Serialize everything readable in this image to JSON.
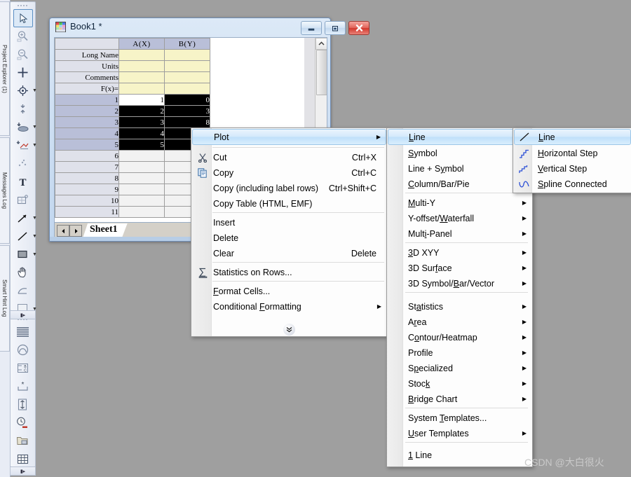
{
  "app": {
    "background_color": "#9f9f9f"
  },
  "left_dock": {
    "tabs": [
      {
        "label": "Project Explorer (1)"
      },
      {
        "label": "Messages Log"
      },
      {
        "label": "Smart Hint Log"
      }
    ]
  },
  "toolbar_main": {
    "name": "Tools",
    "buttons": [
      {
        "icon": "pointer-icon",
        "selected": true
      },
      {
        "icon": "zoom-in-icon",
        "selected": false
      },
      {
        "icon": "zoom-out-icon",
        "selected": false
      },
      {
        "icon": "data-reader-icon",
        "selected": false
      },
      {
        "icon": "screen-reader-icon",
        "selected": false,
        "dropdown": true
      },
      {
        "icon": "data-selector-icon",
        "selected": false
      },
      {
        "icon": "regional-mask-icon",
        "selected": false,
        "dropdown": true
      },
      {
        "icon": "regional-data-icon",
        "selected": false,
        "dropdown": true
      },
      {
        "icon": "scatter-points-icon",
        "selected": false
      },
      {
        "icon": "text-tool-icon",
        "selected": false
      },
      {
        "icon": "rectangle-select-icon",
        "selected": false
      },
      {
        "icon": "arrow-tool-icon",
        "selected": false,
        "dropdown": true
      },
      {
        "icon": "line-tool-icon",
        "selected": false,
        "dropdown": true
      },
      {
        "icon": "rectangle-tool-icon",
        "selected": false,
        "dropdown": true
      },
      {
        "icon": "pan-hand-icon",
        "selected": false
      },
      {
        "icon": "region-tool-icon",
        "selected": false
      },
      {
        "icon": "equation-icon",
        "selected": false,
        "dropdown": true
      },
      {
        "icon": "graph-insert-icon",
        "selected": false,
        "dropdown": true
      },
      {
        "icon": "rotate-hand-icon",
        "selected": false
      },
      {
        "icon": "3d-box-icon",
        "selected": false
      }
    ]
  },
  "toolbar_second": {
    "name": "Object Edit",
    "buttons": [
      {
        "icon": "layers-icon"
      },
      {
        "icon": "speedmode-icon"
      },
      {
        "icon": "rename-icon"
      },
      {
        "icon": "merge-icon"
      },
      {
        "icon": "align-icon"
      },
      {
        "icon": "clock-stamp-icon"
      },
      {
        "icon": "project-stamp-icon"
      },
      {
        "icon": "grid-icon"
      }
    ]
  },
  "workbook": {
    "title": "Book1 *",
    "icon": "workbook-icon",
    "window_buttons": {
      "minimize": "minimize-icon",
      "maximize": "restore-icon",
      "close": "close-icon"
    },
    "columns": [
      "A(X)",
      "B(Y)"
    ],
    "label_rows": [
      {
        "name": "Long Name",
        "values": [
          "",
          ""
        ]
      },
      {
        "name": "Units",
        "values": [
          "",
          ""
        ]
      },
      {
        "name": "Comments",
        "values": [
          "",
          ""
        ]
      },
      {
        "name": "F(x)=",
        "values": [
          "",
          ""
        ]
      }
    ],
    "data_rows": [
      {
        "row": "1",
        "values": [
          "1",
          "0"
        ],
        "selected": true
      },
      {
        "row": "2",
        "values": [
          "2",
          "3"
        ],
        "selected": true
      },
      {
        "row": "3",
        "values": [
          "3",
          "8"
        ],
        "selected": true
      },
      {
        "row": "4",
        "values": [
          "4",
          ""
        ],
        "selected": true
      },
      {
        "row": "5",
        "values": [
          "5",
          ""
        ],
        "selected": true
      },
      {
        "row": "6",
        "values": [
          "",
          ""
        ],
        "selected": false
      },
      {
        "row": "7",
        "values": [
          "",
          ""
        ],
        "selected": false
      },
      {
        "row": "8",
        "values": [
          "",
          ""
        ],
        "selected": false
      },
      {
        "row": "9",
        "values": [
          "",
          ""
        ],
        "selected": false
      },
      {
        "row": "10",
        "values": [
          "",
          ""
        ],
        "selected": false
      },
      {
        "row": "11",
        "values": [
          "",
          ""
        ],
        "selected": false
      }
    ],
    "sheet_tab": "Sheet1",
    "tab_prev_icon": "triangle-left-icon",
    "tab_next_icon": "triangle-right-icon",
    "scroll_up_icon": "chevron-up-icon"
  },
  "context_menu": {
    "items": [
      {
        "label": "Plot",
        "accel": "",
        "icon": "",
        "submenu": true,
        "highlighted": true,
        "sep_after": true
      },
      {
        "label": "Cut",
        "accel": "Ctrl+X",
        "icon": "scissors-icon",
        "submenu": false,
        "highlighted": false
      },
      {
        "label": "Copy",
        "accel": "Ctrl+C",
        "icon": "copy-icon",
        "submenu": false,
        "highlighted": false
      },
      {
        "label": "Copy (including label rows)",
        "accel": "Ctrl+Shift+C",
        "icon": "",
        "submenu": false,
        "highlighted": false
      },
      {
        "label": "Copy Table (HTML, EMF)",
        "accel": "",
        "icon": "",
        "submenu": false,
        "highlighted": false,
        "sep_after": true
      },
      {
        "label": "Insert",
        "accel": "",
        "icon": "",
        "submenu": false,
        "highlighted": false
      },
      {
        "label": "Delete",
        "accel": "",
        "icon": "",
        "submenu": false,
        "highlighted": false
      },
      {
        "label": "Clear",
        "accel": "Delete",
        "icon": "",
        "submenu": false,
        "highlighted": false,
        "sep_after": true
      },
      {
        "label": "Statistics on Rows...",
        "accel": "",
        "icon": "sigma-icon",
        "submenu": false,
        "highlighted": false,
        "sep_after": true
      },
      {
        "label": "Format Cells...",
        "accel": "",
        "icon": "",
        "submenu": false,
        "highlighted": false,
        "accel_char": "F"
      },
      {
        "label": "Conditional Formatting",
        "accel": "",
        "icon": "",
        "submenu": true,
        "highlighted": false,
        "accel_char": "F"
      }
    ],
    "expander_icon": "chevron-double-down-icon"
  },
  "plot_menu": {
    "items": [
      {
        "label": "Line",
        "accel_char": "L",
        "submenu": true,
        "highlighted": true
      },
      {
        "label": "Symbol",
        "accel_char": "S",
        "submenu": true,
        "highlighted": false
      },
      {
        "label": "Line + Symbol",
        "accel_char": "y",
        "submenu": true,
        "highlighted": false
      },
      {
        "label": "Column/Bar/Pie",
        "accel_char": "C",
        "submenu": true,
        "highlighted": false,
        "sep_after": true
      },
      {
        "label": "Multi-Y",
        "accel_char": "M",
        "submenu": true,
        "highlighted": false
      },
      {
        "label": "Y-offset/Waterfall",
        "accel_char": "W",
        "submenu": true,
        "highlighted": false
      },
      {
        "label": "Multi-Panel",
        "accel_char": "i",
        "submenu": true,
        "highlighted": false,
        "sep_after": true
      },
      {
        "label": "3D XYY",
        "accel_char": "3",
        "submenu": true,
        "highlighted": false
      },
      {
        "label": "3D Surface",
        "accel_char": "f",
        "submenu": true,
        "highlighted": false
      },
      {
        "label": "3D Symbol/Bar/Vector",
        "accel_char": "B",
        "submenu": true,
        "highlighted": false,
        "sep_after": true
      },
      {
        "label": "Statistics",
        "accel_char": "a",
        "submenu": true,
        "highlighted": false
      },
      {
        "label": "Area",
        "accel_char": "r",
        "submenu": true,
        "highlighted": false
      },
      {
        "label": "Contour/Heatmap",
        "accel_char": "o",
        "submenu": true,
        "highlighted": false
      },
      {
        "label": "Profile",
        "accel_char": "",
        "submenu": true,
        "highlighted": false
      },
      {
        "label": "Specialized",
        "accel_char": "p",
        "submenu": true,
        "highlighted": false
      },
      {
        "label": "Stock",
        "accel_char": "k",
        "submenu": true,
        "highlighted": false
      },
      {
        "label": "Bridge Chart",
        "accel_char": "B",
        "submenu": true,
        "highlighted": false,
        "sep_after": true
      },
      {
        "label": "System Templates...",
        "accel_char": "T",
        "submenu": false,
        "highlighted": false
      },
      {
        "label": "User Templates",
        "accel_char": "U",
        "submenu": true,
        "highlighted": false,
        "sep_after": true
      },
      {
        "label": "1 Line",
        "accel_char": "1",
        "submenu": false,
        "highlighted": false
      }
    ]
  },
  "line_menu": {
    "items": [
      {
        "label": "Line",
        "accel_char": "L",
        "icon": "line-plot-icon",
        "highlighted": true
      },
      {
        "label": "Horizontal Step",
        "accel_char": "H",
        "icon": "horizontal-step-icon",
        "highlighted": false
      },
      {
        "label": "Vertical Step",
        "accel_char": "V",
        "icon": "vertical-step-icon",
        "highlighted": false
      },
      {
        "label": "Spline Connected",
        "accel_char": "S",
        "icon": "spline-icon",
        "highlighted": false
      }
    ]
  },
  "watermark": {
    "text": "CSDN @大白很火"
  }
}
